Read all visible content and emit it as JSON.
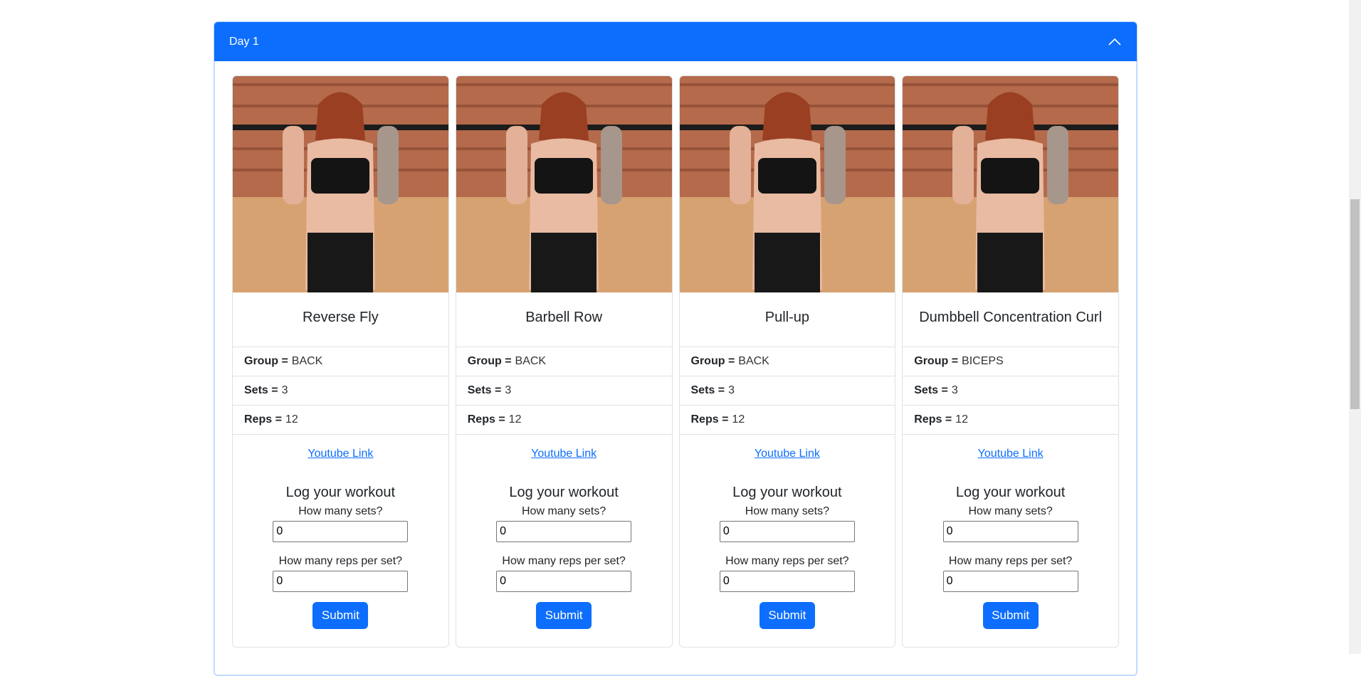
{
  "accordion": {
    "header_label": "Day 1",
    "colors": {
      "header_bg": "#0d6efd",
      "button_bg": "#0d6efd",
      "link": "#0d6efd"
    }
  },
  "cards": [
    {
      "title": "Reverse Fly",
      "group_label": "Group =",
      "group": "BACK",
      "sets_label": "Sets =",
      "sets": "3",
      "reps_label": "Reps =",
      "reps": "12",
      "link": "Youtube Link",
      "log_title": "Log your workout",
      "sets_q": "How many sets?",
      "sets_value": "0",
      "reps_q": "How many reps per set?",
      "reps_value": "0",
      "submit": "Submit"
    },
    {
      "title": "Barbell Row",
      "group_label": "Group =",
      "group": "BACK",
      "sets_label": "Sets =",
      "sets": "3",
      "reps_label": "Reps =",
      "reps": "12",
      "link": "Youtube Link",
      "log_title": "Log your workout",
      "sets_q": "How many sets?",
      "sets_value": "0",
      "reps_q": "How many reps per set?",
      "reps_value": "0",
      "submit": "Submit"
    },
    {
      "title": "Pull-up",
      "group_label": "Group =",
      "group": "BACK",
      "sets_label": "Sets =",
      "sets": "3",
      "reps_label": "Reps =",
      "reps": "12",
      "link": "Youtube Link",
      "log_title": "Log your workout",
      "sets_q": "How many sets?",
      "sets_value": "0",
      "reps_q": "How many reps per set?",
      "reps_value": "0",
      "submit": "Submit"
    },
    {
      "title": "Dumbbell Concentration Curl",
      "group_label": "Group =",
      "group": "BICEPS",
      "sets_label": "Sets =",
      "sets": "3",
      "reps_label": "Reps =",
      "reps": "12",
      "link": "Youtube Link",
      "log_title": "Log your workout",
      "sets_q": "How many sets?",
      "sets_value": "0",
      "reps_q": "How many reps per set?",
      "reps_value": "0",
      "submit": "Submit"
    }
  ]
}
